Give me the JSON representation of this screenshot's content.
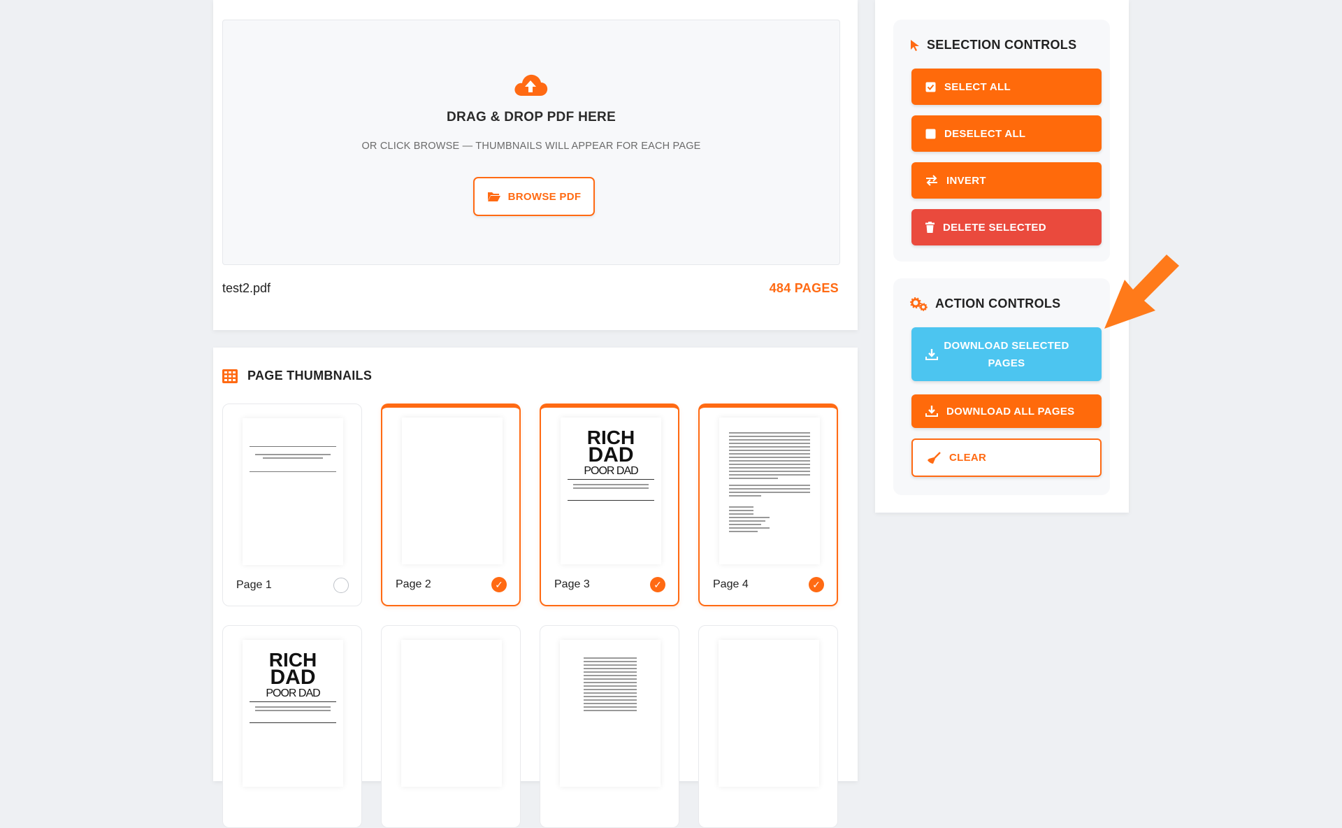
{
  "upload": {
    "drop_title": "DRAG & DROP PDF HERE",
    "drop_subtitle": "OR CLICK BROWSE — THUMBNAILS WILL APPEAR FOR EACH PAGE",
    "browse_label": "BROWSE PDF",
    "file_name": "test2.pdf",
    "page_count": "484 PAGES"
  },
  "thumbnails": {
    "title": "PAGE THUMBNAILS",
    "pages": [
      {
        "label": "Page 1",
        "selected": false
      },
      {
        "label": "Page 2",
        "selected": true
      },
      {
        "label": "Page 3",
        "selected": true
      },
      {
        "label": "Page 4",
        "selected": true
      }
    ],
    "cover": {
      "line1": "RICH",
      "line2": "DAD",
      "line3": "POOR DAD"
    }
  },
  "selection_controls": {
    "title": "SELECTION CONTROLS",
    "select_all": "SELECT ALL",
    "deselect_all": "DESELECT ALL",
    "invert": "INVERT",
    "delete_selected": "DELETE SELECTED"
  },
  "action_controls": {
    "title": "ACTION CONTROLS",
    "download_selected_line1": "DOWNLOAD SELECTED",
    "download_selected_line2": "PAGES",
    "download_all": "DOWNLOAD ALL PAGES",
    "clear": "CLEAR"
  },
  "colors": {
    "accent": "#ff6a13",
    "danger": "#ea4a3d",
    "info": "#4cc5f0"
  },
  "icons": [
    "cloud-upload-icon",
    "folder-open-icon",
    "grid-icon",
    "cursor-icon",
    "checkbox-icon",
    "square-icon",
    "swap-icon",
    "trash-icon",
    "gears-icon",
    "download-icon",
    "broom-icon",
    "check-icon",
    "arrow-pointer-icon"
  ]
}
